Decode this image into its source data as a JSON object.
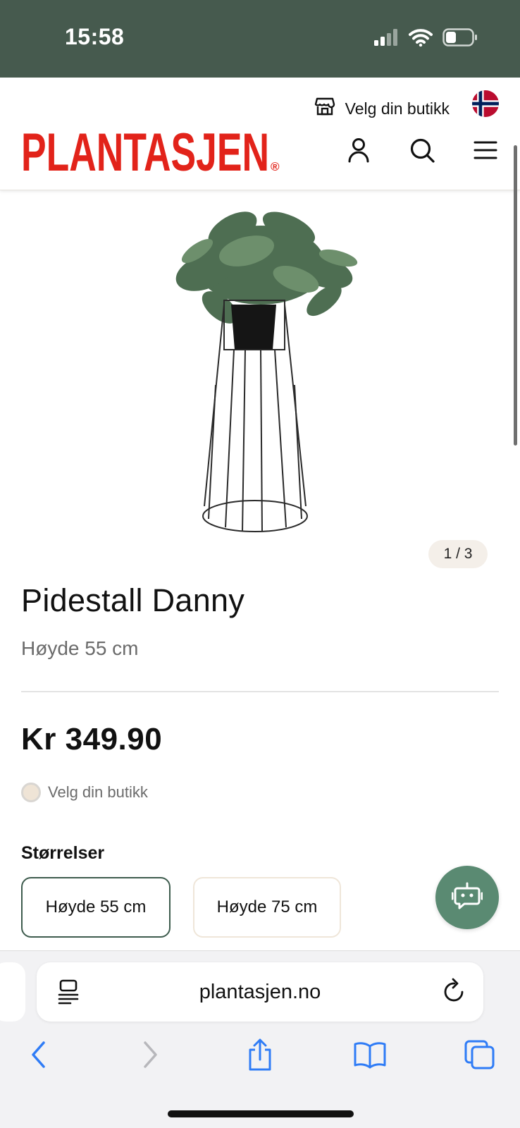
{
  "status_bar": {
    "time": "15:58"
  },
  "header": {
    "store_label": "Velg din butikk",
    "logo_text": "PLANTASJEN",
    "logo_mark": "®"
  },
  "gallery": {
    "counter": "1 / 3"
  },
  "product": {
    "title": "Pidestall Danny",
    "subtitle": "Høyde 55 cm",
    "price": "Kr 349.90",
    "store_status": "Velg din butikk"
  },
  "sizes": {
    "heading": "Størrelser",
    "options": [
      "Høyde 55 cm",
      "Høyde 75 cm"
    ],
    "selected": "Høyde 55 cm"
  },
  "browser": {
    "url": "plantasjen.no"
  },
  "colors": {
    "status_bar": "#465a4e",
    "brand_red": "#e2231a",
    "accent_green": "#3e5c4e",
    "chat_button": "#5a8a72",
    "ios_blue": "#2f7cf6"
  }
}
